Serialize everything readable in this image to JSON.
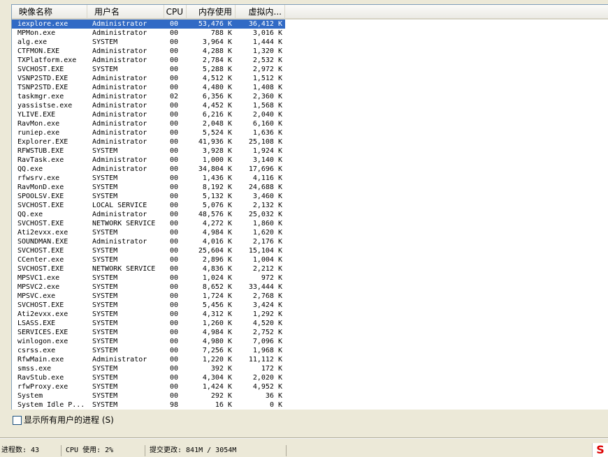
{
  "columns": {
    "name": "映像名称",
    "user": "用户名",
    "cpu": "CPU",
    "mem": "内存使用",
    "vm": "虚拟内..."
  },
  "processes": [
    {
      "name": "iexplore.exe",
      "user": "Administrator",
      "cpu": "00",
      "mem": "53,476 K",
      "vm": "36,412 K",
      "selected": true
    },
    {
      "name": "MPMon.exe",
      "user": "Administrator",
      "cpu": "00",
      "mem": "788 K",
      "vm": "3,016 K"
    },
    {
      "name": "alg.exe",
      "user": "SYSTEM",
      "cpu": "00",
      "mem": "3,964 K",
      "vm": "1,444 K"
    },
    {
      "name": "CTFMON.EXE",
      "user": "Administrator",
      "cpu": "00",
      "mem": "4,288 K",
      "vm": "1,320 K"
    },
    {
      "name": "TXPlatform.exe",
      "user": "Administrator",
      "cpu": "00",
      "mem": "2,784 K",
      "vm": "2,532 K"
    },
    {
      "name": "SVCHOST.EXE",
      "user": "SYSTEM",
      "cpu": "00",
      "mem": "5,288 K",
      "vm": "2,972 K"
    },
    {
      "name": "VSNP2STD.EXE",
      "user": "Administrator",
      "cpu": "00",
      "mem": "4,512 K",
      "vm": "1,512 K"
    },
    {
      "name": "TSNP2STD.EXE",
      "user": "Administrator",
      "cpu": "00",
      "mem": "4,480 K",
      "vm": "1,408 K"
    },
    {
      "name": "taskmgr.exe",
      "user": "Administrator",
      "cpu": "02",
      "mem": "6,356 K",
      "vm": "2,360 K"
    },
    {
      "name": "yassistse.exe",
      "user": "Administrator",
      "cpu": "00",
      "mem": "4,452 K",
      "vm": "1,568 K"
    },
    {
      "name": "YLIVE.EXE",
      "user": "Administrator",
      "cpu": "00",
      "mem": "6,216 K",
      "vm": "2,040 K"
    },
    {
      "name": "RavMon.exe",
      "user": "Administrator",
      "cpu": "00",
      "mem": "2,048 K",
      "vm": "6,160 K"
    },
    {
      "name": "runiep.exe",
      "user": "Administrator",
      "cpu": "00",
      "mem": "5,524 K",
      "vm": "1,636 K"
    },
    {
      "name": "Explorer.EXE",
      "user": "Administrator",
      "cpu": "00",
      "mem": "41,936 K",
      "vm": "25,108 K"
    },
    {
      "name": "RFWSTUB.EXE",
      "user": "SYSTEM",
      "cpu": "00",
      "mem": "3,928 K",
      "vm": "1,924 K"
    },
    {
      "name": "RavTask.exe",
      "user": "Administrator",
      "cpu": "00",
      "mem": "1,000 K",
      "vm": "3,140 K"
    },
    {
      "name": "QQ.exe",
      "user": "Administrator",
      "cpu": "00",
      "mem": "34,804 K",
      "vm": "17,696 K"
    },
    {
      "name": "rfwsrv.exe",
      "user": "SYSTEM",
      "cpu": "00",
      "mem": "1,436 K",
      "vm": "4,116 K"
    },
    {
      "name": "RavMonD.exe",
      "user": "SYSTEM",
      "cpu": "00",
      "mem": "8,192 K",
      "vm": "24,688 K"
    },
    {
      "name": "SPOOLSV.EXE",
      "user": "SYSTEM",
      "cpu": "00",
      "mem": "5,132 K",
      "vm": "3,460 K"
    },
    {
      "name": "SVCHOST.EXE",
      "user": "LOCAL SERVICE",
      "cpu": "00",
      "mem": "5,076 K",
      "vm": "2,132 K"
    },
    {
      "name": "QQ.exe",
      "user": "Administrator",
      "cpu": "00",
      "mem": "48,576 K",
      "vm": "25,032 K"
    },
    {
      "name": "SVCHOST.EXE",
      "user": "NETWORK SERVICE",
      "cpu": "00",
      "mem": "4,272 K",
      "vm": "1,860 K"
    },
    {
      "name": "Ati2evxx.exe",
      "user": "SYSTEM",
      "cpu": "00",
      "mem": "4,984 K",
      "vm": "1,620 K"
    },
    {
      "name": "SOUNDMAN.EXE",
      "user": "Administrator",
      "cpu": "00",
      "mem": "4,016 K",
      "vm": "2,176 K"
    },
    {
      "name": "SVCHOST.EXE",
      "user": "SYSTEM",
      "cpu": "00",
      "mem": "25,604 K",
      "vm": "15,104 K"
    },
    {
      "name": "CCenter.exe",
      "user": "SYSTEM",
      "cpu": "00",
      "mem": "2,896 K",
      "vm": "1,004 K"
    },
    {
      "name": "SVCHOST.EXE",
      "user": "NETWORK SERVICE",
      "cpu": "00",
      "mem": "4,836 K",
      "vm": "2,212 K"
    },
    {
      "name": "MPSVC1.exe",
      "user": "SYSTEM",
      "cpu": "00",
      "mem": "1,024 K",
      "vm": "972 K"
    },
    {
      "name": "MPSVC2.exe",
      "user": "SYSTEM",
      "cpu": "00",
      "mem": "8,652 K",
      "vm": "33,444 K"
    },
    {
      "name": "MPSVC.exe",
      "user": "SYSTEM",
      "cpu": "00",
      "mem": "1,724 K",
      "vm": "2,768 K"
    },
    {
      "name": "SVCHOST.EXE",
      "user": "SYSTEM",
      "cpu": "00",
      "mem": "5,456 K",
      "vm": "3,424 K"
    },
    {
      "name": "Ati2evxx.exe",
      "user": "SYSTEM",
      "cpu": "00",
      "mem": "4,312 K",
      "vm": "1,292 K"
    },
    {
      "name": "LSASS.EXE",
      "user": "SYSTEM",
      "cpu": "00",
      "mem": "1,260 K",
      "vm": "4,520 K"
    },
    {
      "name": "SERVICES.EXE",
      "user": "SYSTEM",
      "cpu": "00",
      "mem": "4,984 K",
      "vm": "2,752 K"
    },
    {
      "name": "winlogon.exe",
      "user": "SYSTEM",
      "cpu": "00",
      "mem": "4,980 K",
      "vm": "7,096 K"
    },
    {
      "name": "csrss.exe",
      "user": "SYSTEM",
      "cpu": "00",
      "mem": "7,256 K",
      "vm": "1,968 K"
    },
    {
      "name": "RfwMain.exe",
      "user": "Administrator",
      "cpu": "00",
      "mem": "1,220 K",
      "vm": "11,112 K"
    },
    {
      "name": "smss.exe",
      "user": "SYSTEM",
      "cpu": "00",
      "mem": "392 K",
      "vm": "172 K"
    },
    {
      "name": "RavStub.exe",
      "user": "SYSTEM",
      "cpu": "00",
      "mem": "4,304 K",
      "vm": "2,020 K"
    },
    {
      "name": "rfwProxy.exe",
      "user": "SYSTEM",
      "cpu": "00",
      "mem": "1,424 K",
      "vm": "4,952 K"
    },
    {
      "name": "System",
      "user": "SYSTEM",
      "cpu": "00",
      "mem": "292 K",
      "vm": "36 K"
    },
    {
      "name": "System Idle P...",
      "user": "SYSTEM",
      "cpu": "98",
      "mem": "16 K",
      "vm": "0 K"
    }
  ],
  "show_all_users": {
    "label": "显示所有用户的进程 (S)",
    "checked": false
  },
  "status": {
    "processes": "进程数: 43",
    "cpu": "CPU 使用: 2%",
    "commit": "提交更改: 841M / 3054M"
  },
  "badge": "S",
  "colors": {
    "selection": "#316ac5",
    "window": "#ece9d8"
  }
}
